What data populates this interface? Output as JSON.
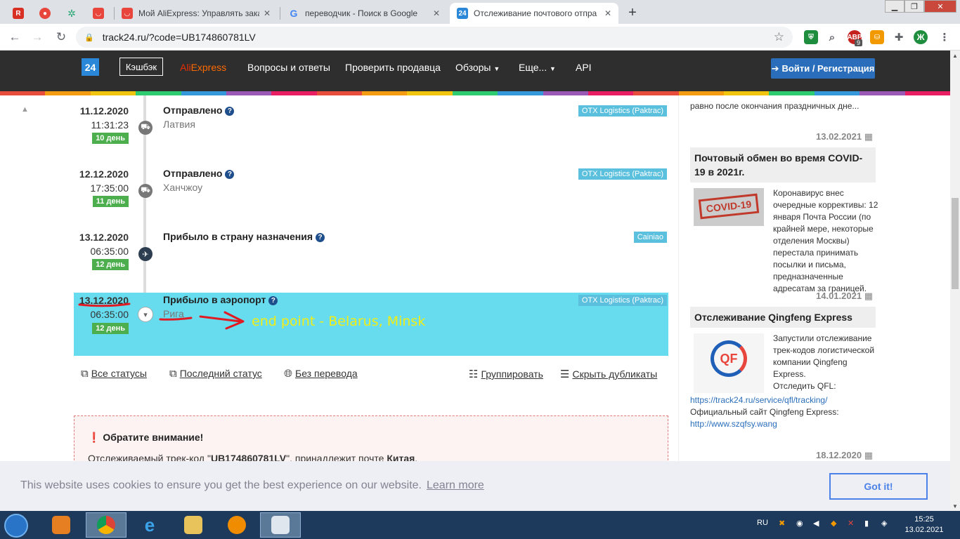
{
  "browser": {
    "tabs": [
      {
        "title": "",
        "pinned": true
      },
      {
        "title": "",
        "pinned": true
      },
      {
        "title": "",
        "pinned": true
      },
      {
        "title": "",
        "pinned": true
      },
      {
        "title": "Мой AliExpress: Управлять заказ",
        "pinned": false
      },
      {
        "title": "переводчик - Поиск в Google",
        "pinned": false
      },
      {
        "title": "Отслеживание почтового отпра",
        "pinned": false,
        "active": true
      }
    ],
    "url": "track24.ru/?code=UB174860781LV",
    "ext_badge": "9",
    "profile_initial": "Ж"
  },
  "site": {
    "logo": "24",
    "cashback": "Кэшбэк",
    "aliexpress_a": "Ali",
    "aliexpress_b": "Express",
    "nav": [
      "Вопросы и ответы",
      "Проверить продавца",
      "Обзоры",
      "Еще...",
      "API"
    ],
    "login": "Войти / Регистрация"
  },
  "events": [
    {
      "date": "11.12.2020",
      "time": "11:31:23",
      "day": "10 день",
      "status": "Отправлено",
      "place": "Латвия",
      "carrier": "OTX Logistics (Paktrac)"
    },
    {
      "date": "12.12.2020",
      "time": "17:35:00",
      "day": "11 день",
      "status": "Отправлено",
      "place": "Ханчжоу",
      "carrier": "OTX Logistics (Paktrac)"
    },
    {
      "date": "13.12.2020",
      "time": "06:35:00",
      "day": "12 день",
      "status": "Прибыло в страну назначения",
      "place": "",
      "carrier": "Cainiao"
    },
    {
      "date": "13.12.2020",
      "time": "06:35:00",
      "day": "12 день",
      "status": "Прибыло в аэропорт",
      "place": "Рига",
      "carrier": "OTX Logistics (Paktrac)"
    }
  ],
  "annotation": "end point - Belarus, Minsk",
  "links": {
    "all": "Все статусы",
    "last": "Последний статус",
    "notrans": "Без перевода",
    "group": "Группировать",
    "hide_dup": "Скрыть дубликаты"
  },
  "notice": {
    "title": "Обратите внимание!",
    "body_prefix": "Отслеживаемый трек-код \"",
    "code": "UB174860781LV",
    "body_mid": "\", принадлежит почте ",
    "country": "Китая",
    "body_end": "."
  },
  "sidebar": {
    "top_text": "равно после окончания праздничных дне...",
    "news": [
      {
        "date": "13.02.2021",
        "title": "Почтовый обмен во время COVID-19 в 2021г.",
        "text": "Коронавирус внес очередные коррективы: 12 января Почта России (по крайней мере, некоторые отделения Москвы) перестала принимать посылки и письма, предназначенные адресатам за границей."
      },
      {
        "date": "14.01.2021",
        "title": "Отслеживание Qingfeng Express",
        "text": "Запустили отслеживание трек-кодов логистической компании Qingfeng Express.",
        "track_label": "Отследить QFL:",
        "track_url": "https://track24.ru/service/qfl/tracking/",
        "site_label": "Официальный сайт Qingfeng Express:",
        "site_url": "http://www.szqfsy.wang"
      }
    ],
    "next_date": "18.12.2020",
    "covid_stamp": "COVID-19",
    "qf_logo": "QF"
  },
  "cookie": {
    "message": "This website uses cookies to ensure you get the best experience on our website.",
    "learn_more": "Learn more",
    "got_it": "Got it!"
  },
  "taskbar": {
    "lang": "RU",
    "time": "15:25",
    "date": "13.02.2021"
  },
  "colors": {
    "header_bg": "#2e2e2e",
    "highlight_row": "#66dcee",
    "day_badge": "#4cae4c",
    "carrier_badge": "#5bc0de",
    "login_btn": "#2a6ebb",
    "annotation": "#f2ed14",
    "annotation_marks": "#e01b24"
  }
}
